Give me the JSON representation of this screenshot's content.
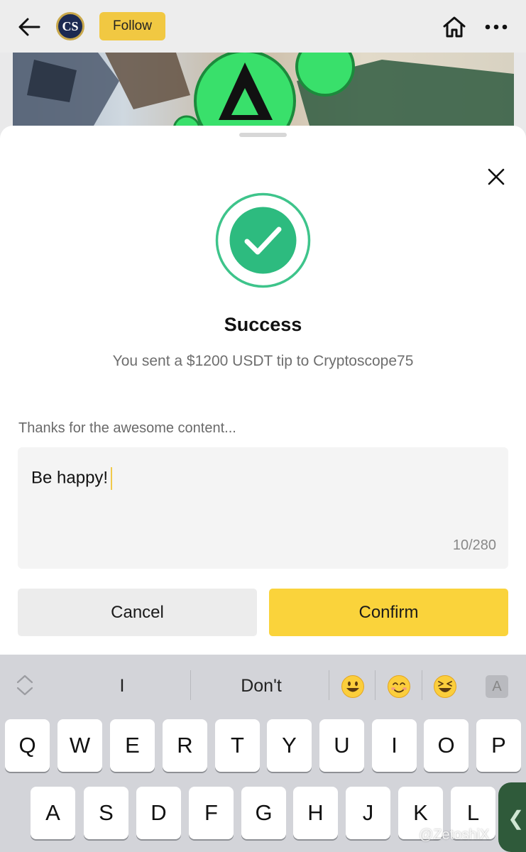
{
  "header": {
    "avatar_text": "CS",
    "follow_label": "Follow"
  },
  "dialog": {
    "title": "Success",
    "message": "You sent a $1200 USDT tip to Cryptoscope75",
    "prompt": "Thanks for the awesome content...",
    "input_value": "Be happy!",
    "char_count": "10/280",
    "cancel_label": "Cancel",
    "confirm_label": "Confirm"
  },
  "keyboard": {
    "suggestions": [
      "I",
      "Don't"
    ],
    "emoji": [
      "smiley-emoji",
      "smiling-face-emoji",
      "laughing-emoji"
    ],
    "mode_key": "A",
    "row1": [
      "Q",
      "W",
      "E",
      "R",
      "T",
      "Y",
      "U",
      "I",
      "O",
      "P"
    ],
    "row2": [
      "A",
      "S",
      "D",
      "F",
      "G",
      "H",
      "J",
      "K",
      "L"
    ]
  },
  "watermark": "@ZetoshiX",
  "colors": {
    "accent": "#fad33b",
    "follow": "#f1c842",
    "success_green": "#2dbb7f",
    "success_ring": "#3ec48b"
  }
}
